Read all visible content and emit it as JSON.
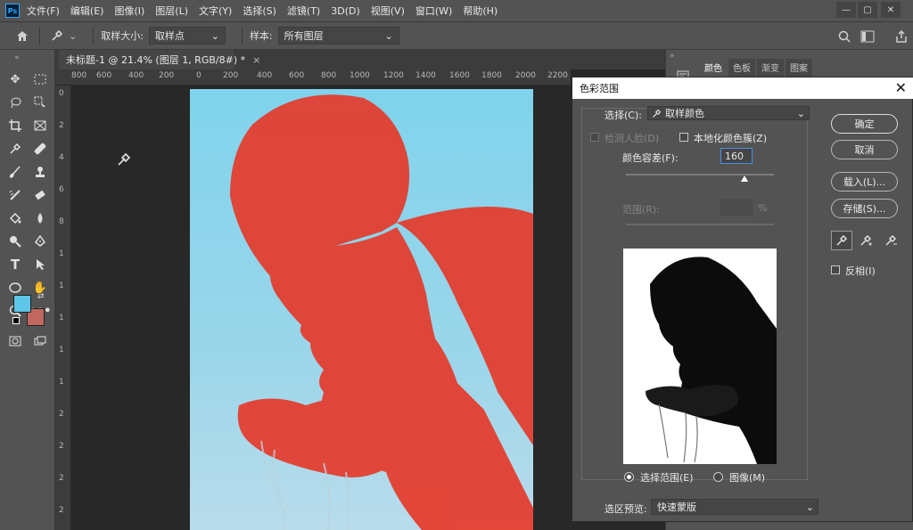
{
  "menubar": {
    "items": [
      "文件(F)",
      "编辑(E)",
      "图像(I)",
      "图层(L)",
      "文字(Y)",
      "选择(S)",
      "滤镜(T)",
      "3D(D)",
      "视图(V)",
      "窗口(W)",
      "帮助(H)"
    ],
    "logo": "Ps",
    "window_buttons": [
      "—",
      "▢",
      "✕"
    ]
  },
  "options": {
    "sample_size_label": "取样大小:",
    "sample_size_value": "取样点",
    "sample_label": "样本:",
    "sample_value": "所有图层"
  },
  "document": {
    "tab_title": "未标题-1 @ 21.4% (图层 1, RGB/8#) *",
    "tab_close": "×"
  },
  "ruler": {
    "h_ticks": [
      "800",
      "600",
      "400",
      "200",
      "0",
      "200",
      "400",
      "600",
      "800",
      "1000",
      "1200",
      "1400",
      "1600",
      "1800",
      "2000",
      "2200"
    ],
    "v_ticks": [
      "0",
      "2",
      "4",
      "6",
      "8",
      "1",
      "1",
      "1",
      "1",
      "1",
      "2",
      "2",
      "2",
      "2"
    ]
  },
  "panel_tabs": [
    "颜色",
    "色板",
    "渐变",
    "图案"
  ],
  "dialog": {
    "title": "色彩范围",
    "close": "✕",
    "select_label": "选择(C):",
    "select_value": "取样颜色",
    "detect_faces_label": "检测人脸(D)",
    "localized_label": "本地化颜色簇(Z)",
    "fuzziness_label": "颜色容差(F):",
    "fuzziness_value": "160",
    "range_label": "范围(R):",
    "range_unit": "%",
    "ok_label": "确定",
    "cancel_label": "取消",
    "load_label": "载入(L)...",
    "save_label": "存储(S)...",
    "invert_label": "反相(I)",
    "radio_selection_label": "选择范围(E)",
    "radio_image_label": "图像(M)",
    "preview_label": "选区预览:",
    "preview_value": "快速蒙版",
    "fuzziness_fraction": 0.8
  },
  "colors": {
    "foreground": "#5ec6e6",
    "background": "#c0685f",
    "selection_overlay": "#e53a2a"
  }
}
